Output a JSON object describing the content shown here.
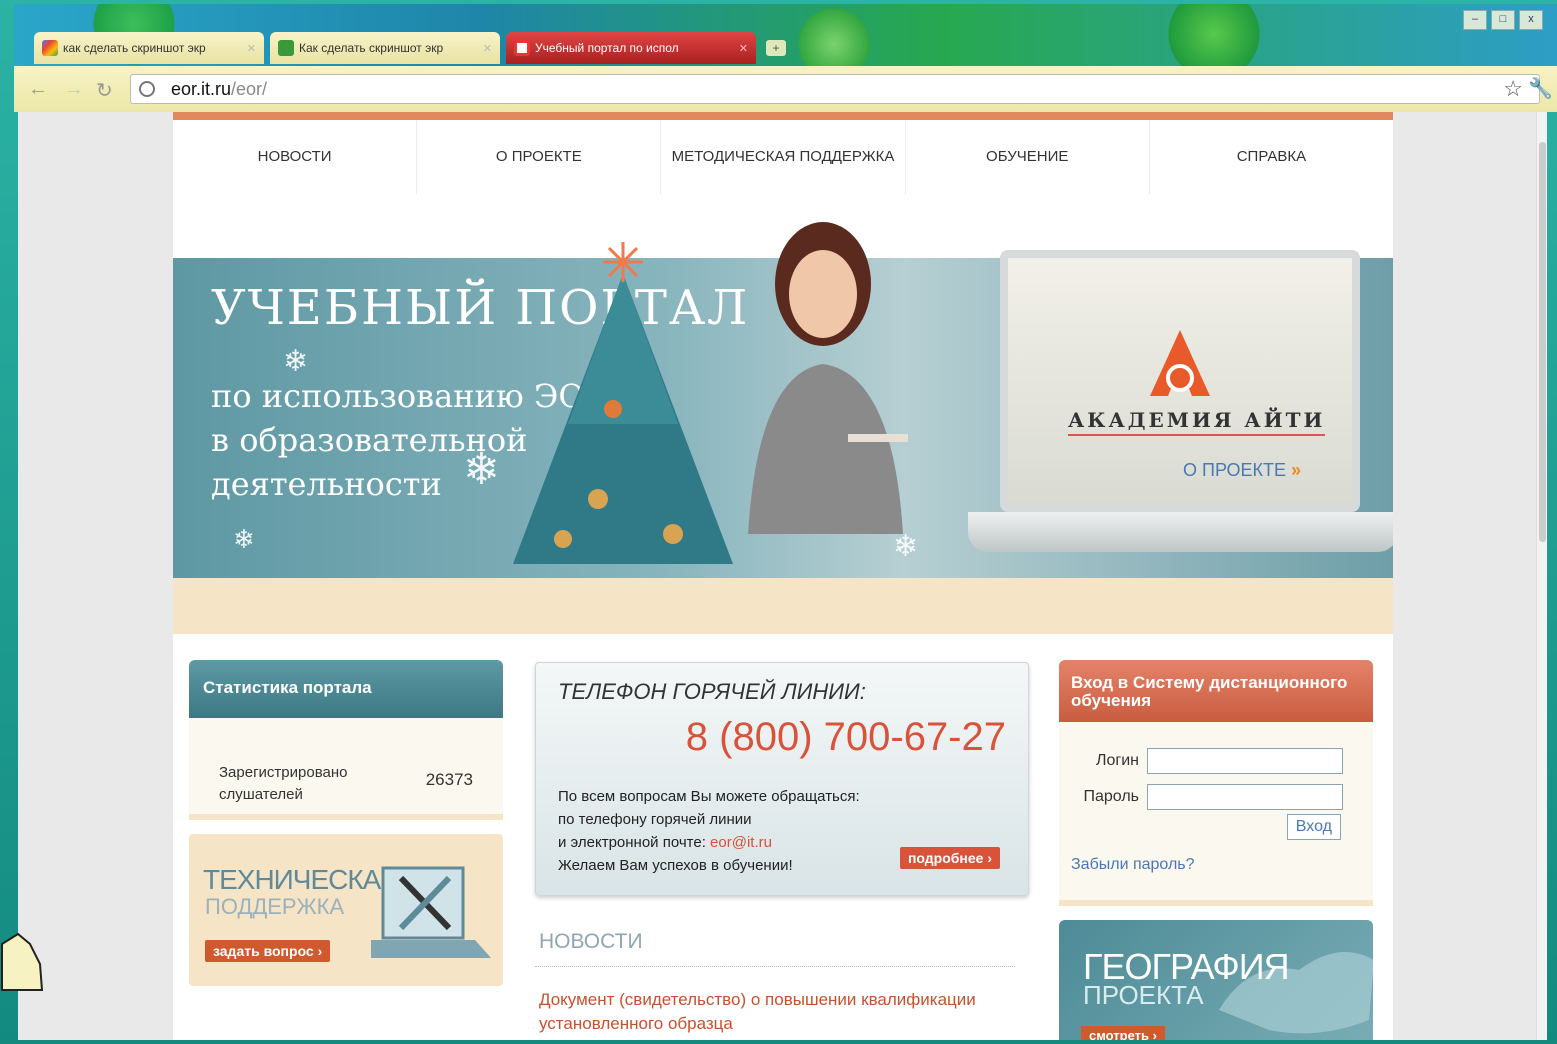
{
  "browser": {
    "tabs": [
      {
        "title": "как сделать скриншот экр",
        "active": false,
        "favicon": "google-icon"
      },
      {
        "title": "Как сделать скриншот экр",
        "active": false,
        "favicon": "arrow-icon"
      },
      {
        "title": "Учебный портал по испол",
        "active": true,
        "favicon": "academy-icon"
      }
    ],
    "new_tab": "+",
    "url_host": "eor.it.ru",
    "url_path": "/eor/",
    "window_controls": [
      "–",
      "□",
      "x"
    ]
  },
  "menu": [
    "НОВОСТИ",
    "О ПРОЕКТЕ",
    "МЕТОДИЧЕСКАЯ ПОДДЕРЖКА",
    "ОБУЧЕНИЕ",
    "СПРАВКА"
  ],
  "banner": {
    "title": "УЧЕБНЫЙ ПОРТАЛ",
    "subtitle_lines": [
      "по использованию ЭОР",
      "в образовательной",
      "деятельности"
    ],
    "academy_name": "АКАДЕМИЯ АЙТИ",
    "about_link": "О ПРОЕКТЕ",
    "about_arrow": "»"
  },
  "stats": {
    "header": "Статистика портала",
    "label": "Зарегистрировано слушателей",
    "value": "26373"
  },
  "tech_support": {
    "line1": "ТЕХНИЧЕСКАЯ",
    "line2": "ПОДДЕРЖКА",
    "button": "задать вопрос ›"
  },
  "hotline": {
    "title": "ТЕЛЕФОН ГОРЯЧЕЙ ЛИНИИ:",
    "phone": "8 (800) 700-67-27",
    "line1": "По всем вопросам Вы можете обращаться:",
    "line2": "по телефону горячей линии",
    "line3_prefix": "и электронной почте: ",
    "email": "eor@it.ru",
    "line4": "Желаем Вам успехов в обучении!",
    "more": "подробнее ›"
  },
  "news": {
    "header": "НОВОСТИ",
    "item": "Документ (свидетельство) о повышении квалификации установленного образца"
  },
  "login": {
    "header": "Вход в Систему дистанционного обучения",
    "login_label": "Логин",
    "password_label": "Пароль",
    "submit": "Вход",
    "forgot": "Забыли пароль?"
  },
  "geo": {
    "line1": "ГЕОГРАФИЯ",
    "line2": "ПРОЕКТА",
    "button": "смотреть ›"
  },
  "colors": {
    "accent": "#d8533a",
    "teal": "#4d8b96",
    "link": "#4a78b5"
  }
}
